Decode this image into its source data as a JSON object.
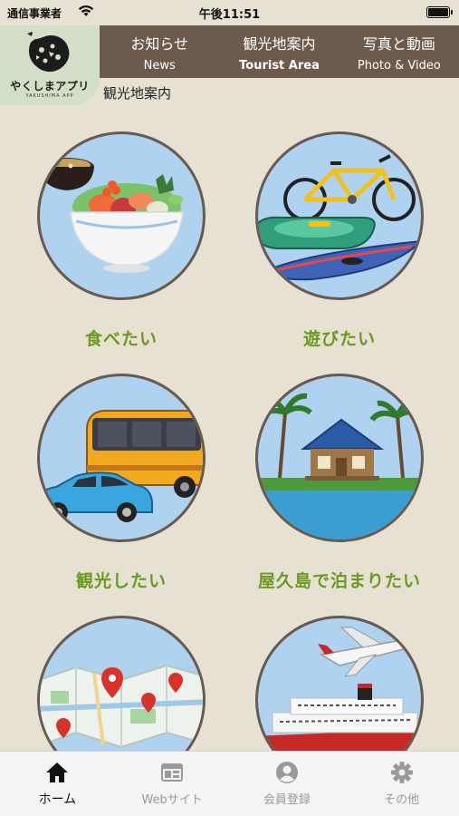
{
  "status_bar": {
    "carrier": "通信事業者",
    "time": "午後11:51"
  },
  "app": {
    "logo_text": "やくしまアプリ",
    "logo_subtext": "YAKUSHIMA APP"
  },
  "nav": {
    "items": [
      {
        "jp": "お知らせ",
        "en": "News"
      },
      {
        "jp": "観光地案内",
        "en": "Tourist Area"
      },
      {
        "jp": "写真と動画",
        "en": "Photo & Video"
      }
    ],
    "active_index": 1
  },
  "section_title": "観光地案内",
  "categories": [
    {
      "label": "食べたい",
      "icon": "food-bowl-icon"
    },
    {
      "label": "遊びたい",
      "icon": "bicycle-kayak-icon"
    },
    {
      "label": "観光したい",
      "icon": "bus-car-icon"
    },
    {
      "label": "屋久島で泊まりたい",
      "icon": "lodge-icon"
    },
    {
      "label": "",
      "icon": "map-pin-icon"
    },
    {
      "label": "",
      "icon": "plane-ship-icon"
    }
  ],
  "tab_bar": {
    "tabs": [
      {
        "label": "ホーム",
        "icon": "home-icon"
      },
      {
        "label": "Webサイト",
        "icon": "browser-icon"
      },
      {
        "label": "会員登録",
        "icon": "user-icon"
      },
      {
        "label": "その他",
        "icon": "gear-icon"
      }
    ],
    "active_index": 0
  },
  "colors": {
    "background": "#e7e1d3",
    "nav_bar": "#6c5a4c",
    "label_green": "#6a9a1e",
    "circle_fill": "#aed2ef",
    "circle_border": "#675a50"
  }
}
